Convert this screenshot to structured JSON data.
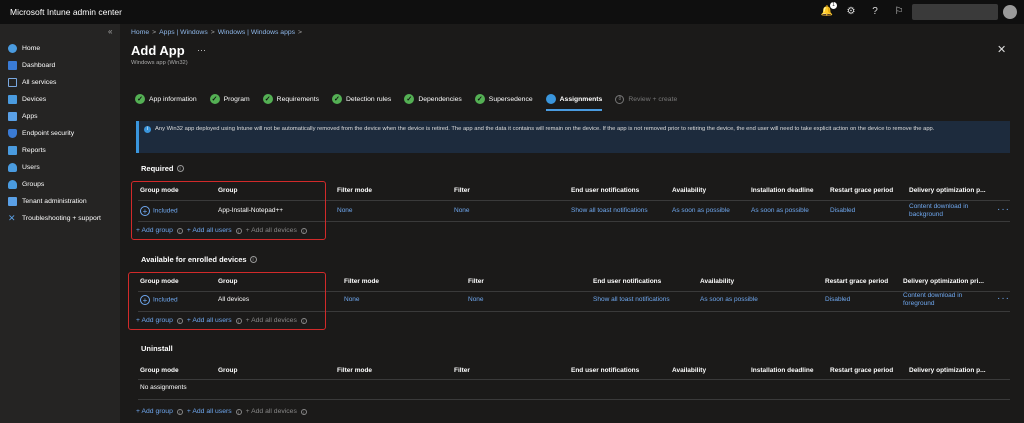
{
  "topbar": {
    "title": "Microsoft Intune admin center",
    "notification_count": "1"
  },
  "sidebar": {
    "items": [
      {
        "label": "Home",
        "color": "#4a9bdf"
      },
      {
        "label": "Dashboard",
        "color": "#3a7bd5"
      },
      {
        "label": "All services",
        "color": "#3a7bd5"
      },
      {
        "label": "Devices",
        "color": "#4a9bdf"
      },
      {
        "label": "Apps",
        "color": "#5aa0e6"
      },
      {
        "label": "Endpoint security",
        "color": "#3a7bd5"
      },
      {
        "label": "Reports",
        "color": "#4a9bdf"
      },
      {
        "label": "Users",
        "color": "#4a9bdf"
      },
      {
        "label": "Groups",
        "color": "#4a9bdf"
      },
      {
        "label": "Tenant administration",
        "color": "#5aa0e6"
      },
      {
        "label": "Troubleshooting + support",
        "color": "#5aa0e6"
      }
    ]
  },
  "breadcrumb": [
    "Home",
    "Apps | Windows",
    "Windows | Windows apps"
  ],
  "page": {
    "title": "Add App",
    "subtitle": "Windows app (Win32)"
  },
  "steps": [
    {
      "label": "App information",
      "state": "done"
    },
    {
      "label": "Program",
      "state": "done"
    },
    {
      "label": "Requirements",
      "state": "done"
    },
    {
      "label": "Detection rules",
      "state": "done"
    },
    {
      "label": "Dependencies",
      "state": "done"
    },
    {
      "label": "Supersedence",
      "state": "done"
    },
    {
      "label": "Assignments",
      "state": "active"
    },
    {
      "label": "Review + create",
      "state": "pending",
      "num": "8"
    }
  ],
  "info_banner": "Any Win32 app deployed using Intune will not be automatically removed from the device when the device is retired. The app and the data it contains will remain on the device. If the app is not removed prior to retiring the device, the end user will need to take explicit action on the device to remove the app.",
  "add_links": {
    "add_group": "+ Add group",
    "add_all_users": "+ Add all users",
    "add_all_devices": "+ Add all devices"
  },
  "required": {
    "title": "Required",
    "headers": [
      "Group mode",
      "Group",
      "Filter mode",
      "Filter",
      "End user notifications",
      "Availability",
      "Installation deadline",
      "Restart grace period",
      "Delivery optimization p..."
    ],
    "row": {
      "group_mode": "Included",
      "group": "App-Install-Notepad++",
      "filter_mode": "None",
      "filter": "None",
      "notifications": "Show all toast notifications",
      "availability": "As soon as possible",
      "deadline": "As soon as possible",
      "restart": "Disabled",
      "delivery": "Content download in background"
    }
  },
  "available": {
    "title": "Available for enrolled devices",
    "headers": [
      "Group mode",
      "Group",
      "Filter mode",
      "Filter",
      "End user notifications",
      "Availability",
      "Restart grace period",
      "Delivery optimization pri..."
    ],
    "row": {
      "group_mode": "Included",
      "group": "All devices",
      "filter_mode": "None",
      "filter": "None",
      "notifications": "Show all toast notifications",
      "availability": "As soon as possible",
      "restart": "Disabled",
      "delivery": "Content download in foreground"
    }
  },
  "uninstall": {
    "title": "Uninstall",
    "headers": [
      "Group mode",
      "Group",
      "Filter mode",
      "Filter",
      "End user notifications",
      "Availability",
      "Installation deadline",
      "Restart grace period",
      "Delivery optimization p..."
    ],
    "empty": "No assignments"
  }
}
